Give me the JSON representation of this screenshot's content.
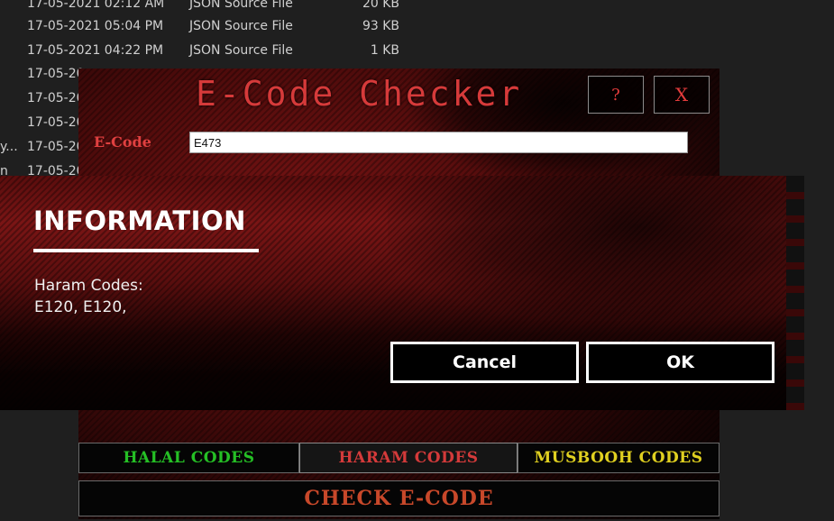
{
  "explorer": {
    "rows": [
      {
        "date": "17-05-2021 02:12 AM",
        "type": "JSON Source File",
        "size": "20 KB"
      },
      {
        "date": "17-05-2021 05:04 PM",
        "type": "JSON Source File",
        "size": "93 KB"
      },
      {
        "date": "17-05-2021 04:22 PM",
        "type": "JSON Source File",
        "size": "1 KB"
      },
      {
        "date": "17-05-20",
        "type": "",
        "size": ""
      },
      {
        "date": "17-05-20",
        "type": "",
        "size": ""
      },
      {
        "date": "17-05-20",
        "type": "",
        "size": ""
      },
      {
        "date": "17-05-20",
        "type": "",
        "size": "",
        "left_fragment": "y..."
      },
      {
        "date": "17-05-20",
        "type": "",
        "size": "",
        "left_fragment": "n"
      }
    ]
  },
  "checker": {
    "title": "E-Code Checker",
    "help_label": "?",
    "close_label": "X",
    "ecode_label": "E-Code",
    "ecode_value": "E473",
    "halal_label": "HALAL CODES",
    "haram_label": "HARAM CODES",
    "musbooh_label": "MUSBOOH CODES",
    "check_label": "CHECK E-CODE"
  },
  "dialog": {
    "title": "INFORMATION",
    "line1": "Haram Codes:",
    "line2": "E120, E120,",
    "cancel_label": "Cancel",
    "ok_label": "OK"
  }
}
